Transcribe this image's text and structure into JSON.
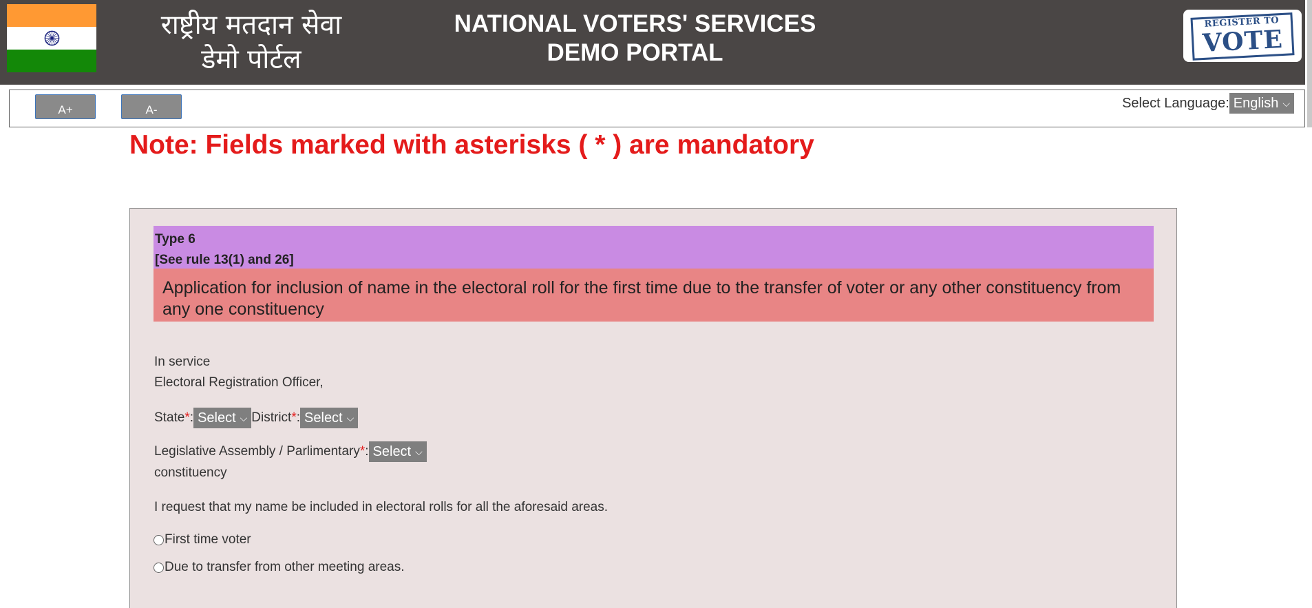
{
  "header": {
    "hindi_title_line1": "राष्ट्रीय मतदान सेवा",
    "hindi_title_line2": "डेमो पोर्टल",
    "english_title_line1": "NATIONAL VOTERS' SERVICES",
    "english_title_line2": "DEMO PORTAL",
    "register_logo_top": "REGISTER TO",
    "register_logo_big": "VOTE"
  },
  "toolbar": {
    "increase_font_label": "A+",
    "decrease_font_label": "A-",
    "language_label": "Select Language:",
    "language_value": "English"
  },
  "note": "Note: Fields marked with asterisks ( * ) are mandatory",
  "form": {
    "type_line": "Type 6",
    "rule_line": "[See rule 13(1) and 26]",
    "application_title": "Application for inclusion of name in the electoral roll for the first time due to the transfer of voter or any other constituency from any one constituency",
    "in_service": "In service",
    "officer": "Electoral Registration Officer,",
    "state_label": "State ",
    "district_label": "District ",
    "asterisk": "*",
    "colon": ":",
    "state_value": "Select",
    "district_value": "Select",
    "assembly_label": "Legislative Assembly / Parlimentary",
    "assembly_value": "Select",
    "constituency_label": "constituency",
    "request_text": "I request that my name be included in electoral rolls for all the aforesaid areas.",
    "radio_first_time": "First time voter",
    "radio_transfer": "Due to transfer from other meeting areas."
  },
  "colors": {
    "header_bg": "#4a4645",
    "note_red": "#e41b1b",
    "type_purple": "#c98be3",
    "title_red": "#e88585",
    "panel_bg": "#ebe1e1"
  }
}
